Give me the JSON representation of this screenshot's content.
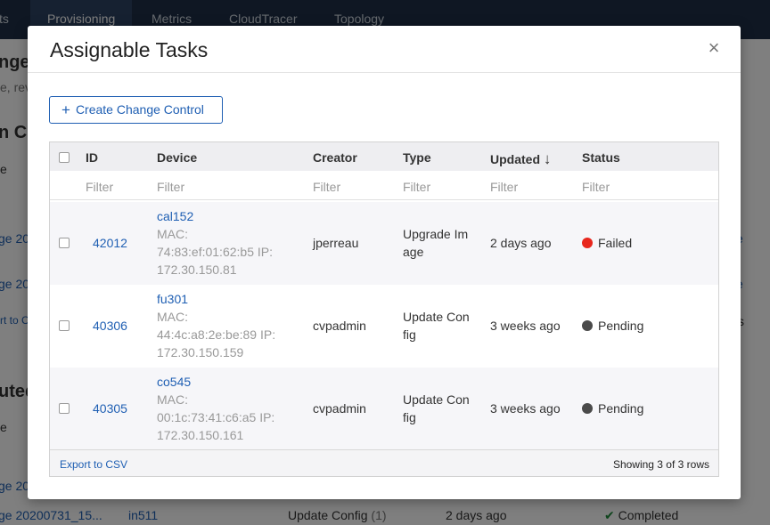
{
  "topnav": {
    "tabs": [
      {
        "label": "ts"
      },
      {
        "label": "Provisioning"
      },
      {
        "label": "Metrics"
      },
      {
        "label": "CloudTracer"
      },
      {
        "label": "Topology"
      }
    ]
  },
  "background": {
    "heading1": "nge",
    "subtext": "e, rev",
    "heading2": "n Ch",
    "col_e": "e",
    "row1": "ge 20",
    "row2": "ge 20",
    "export": "rt to CS",
    "heading3": "uted",
    "col_e2": "e",
    "row3": "ge 20",
    "row4_name": "ge 20200731_15...",
    "row4_device": "in511",
    "row4_type": "Update Config",
    "row4_count": "(1)",
    "row4_updated": "2 days ago",
    "row4_status": "Completed",
    "right1": "e",
    "right2": "e",
    "right3": "s"
  },
  "modal": {
    "title": "Assignable Tasks",
    "close_symbol": "×",
    "create_button": {
      "icon": "plus-icon",
      "label": "Create Change Control"
    }
  },
  "table": {
    "columns": {
      "id": "ID",
      "device": "Device",
      "creator": "Creator",
      "type": "Type",
      "updated": "Updated",
      "sort_arrow": "↓",
      "status": "Status"
    },
    "filter_placeholder": "Filter",
    "rows": [
      {
        "id": "42012",
        "device_name": "cal152",
        "device_mac_line1": "MAC:",
        "device_mac_line2": "74:83:ef:01:62:b5 IP:",
        "device_ip": "172.30.150.81",
        "creator": "jperreau",
        "type_line1": "Upgrade Im",
        "type_line2": "age",
        "updated": "2 days ago",
        "status": "Failed",
        "status_color": "#e8271d"
      },
      {
        "id": "40306",
        "device_name": "fu301",
        "device_mac_line1": "MAC:",
        "device_mac_line2": "44:4c:a8:2e:be:89 IP:",
        "device_ip": "172.30.150.159",
        "creator": "cvpadmin",
        "type_line1": "Update Con",
        "type_line2": "fig",
        "updated": "3 weeks ago",
        "status": "Pending",
        "status_color": "#4a4a4a"
      },
      {
        "id": "40305",
        "device_name": "co545",
        "device_mac_line1": "MAC:",
        "device_mac_line2": "00:1c:73:41:c6:a5 IP:",
        "device_ip": "172.30.150.161",
        "creator": "cvpadmin",
        "type_line1": "Update Con",
        "type_line2": "fig",
        "updated": "3 weeks ago",
        "status": "Pending",
        "status_color": "#4a4a4a"
      }
    ],
    "footer": {
      "export": "Export to CSV",
      "showing": "Showing 3 of 3 rows"
    }
  }
}
